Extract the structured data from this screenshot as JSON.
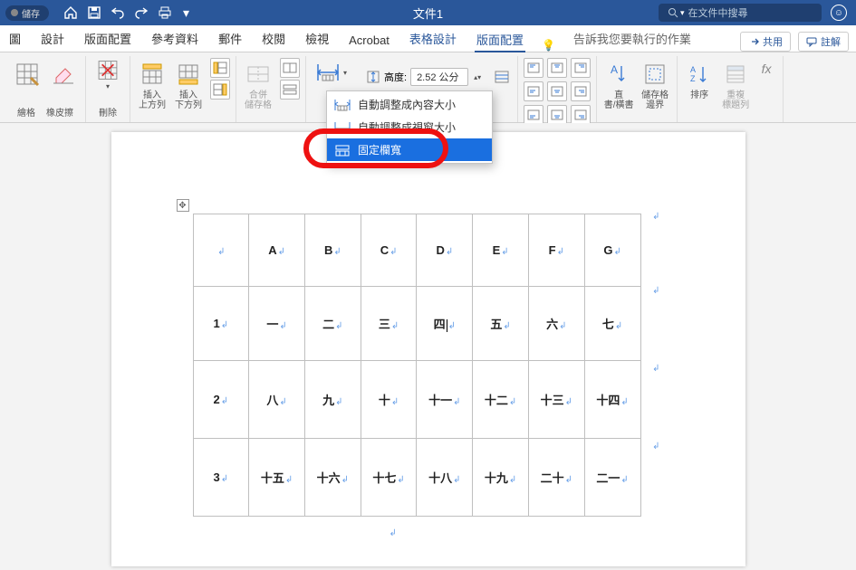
{
  "title_bar": {
    "autosave_label": "儲存",
    "doc_title": "文件1",
    "search_placeholder": "在文件中搜尋"
  },
  "tabs": {
    "items": [
      "圖",
      "設計",
      "版面配置",
      "參考資料",
      "郵件",
      "校閱",
      "檢視",
      "Acrobat",
      "表格設計",
      "版面配置"
    ],
    "tell_me": "告訴我您要執行的作業",
    "share": "共用",
    "comments": "註解"
  },
  "ribbon": {
    "draw_group": "繪格",
    "eraser": "橡皮擦",
    "delete": "刪除",
    "insert_above": "插入\n上方列",
    "insert_below": "插入\n下方列",
    "merge": "合併\n儲存格",
    "height_label": "高度:",
    "height_value": "2.52 公分",
    "dist_group": "",
    "direction": "直\n書/橫書",
    "cell_margin": "儲存格\n邊界",
    "sort": "排序",
    "repeat_header": "重複\n標題列",
    "fx": "fx"
  },
  "dropdown": {
    "item1": "自動調整成內容大小",
    "item2": "自動調整成視窗大小",
    "item3": "固定欄寬"
  },
  "table": {
    "headers": [
      "",
      "A",
      "B",
      "C",
      "D",
      "E",
      "F",
      "G"
    ],
    "rows": [
      {
        "label": "1",
        "cells": [
          "一",
          "二",
          "三",
          "四",
          "五",
          "六",
          "七"
        ]
      },
      {
        "label": "2",
        "cells": [
          "八",
          "九",
          "十",
          "十一",
          "十二",
          "十三",
          "十四"
        ]
      },
      {
        "label": "3",
        "cells": [
          "十五",
          "十六",
          "十七",
          "十八",
          "十九",
          "二十",
          "二一"
        ]
      }
    ]
  }
}
